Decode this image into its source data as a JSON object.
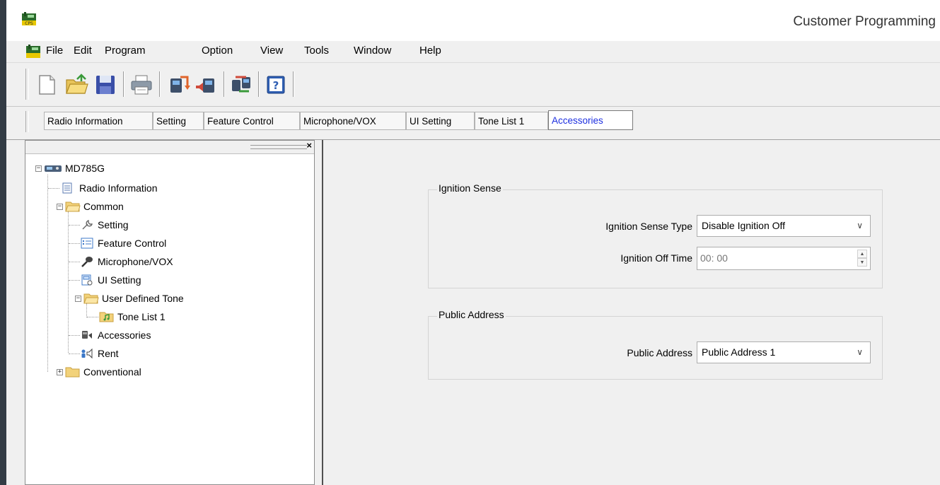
{
  "window": {
    "title": "Customer Programming"
  },
  "menu": {
    "items": [
      "File",
      "Edit",
      "Program",
      "Option",
      "View",
      "Tools",
      "Window",
      "Help"
    ]
  },
  "toolbar": {
    "buttons": [
      "new-file-icon",
      "open-folder-icon",
      "save-icon",
      "print-icon",
      "read-radio-icon",
      "write-radio-icon",
      "clone-radio-icon",
      "help-icon"
    ]
  },
  "tabs": {
    "items": [
      "Radio Information",
      "Setting",
      "Feature Control",
      "Microphone/VOX",
      "UI Setting",
      "Tone List 1",
      "Accessories"
    ],
    "active": "Accessories"
  },
  "tree": {
    "close_label": "×",
    "root": "MD785G",
    "radio_information": "Radio Information",
    "common": "Common",
    "setting": "Setting",
    "feature_control": "Feature Control",
    "microphone_vox": "Microphone/VOX",
    "ui_setting": "UI Setting",
    "user_defined_tone": "User Defined Tone",
    "tone_list_1": "Tone List 1",
    "accessories": "Accessories",
    "rent": "Rent",
    "conventional": "Conventional",
    "selected": "Accessories"
  },
  "ignition": {
    "group_title": "Ignition Sense",
    "type_label": "Ignition Sense Type",
    "type_value": "Disable Ignition Off",
    "off_time_label": "Ignition Off Time",
    "off_time_value": "00: 00"
  },
  "public_address": {
    "group_title": "Public Address",
    "label": "Public Address",
    "value": "Public Address 1"
  },
  "colors": {
    "active_tab_text": "#1d2fe0",
    "panel_background": "#f0f0f0"
  }
}
